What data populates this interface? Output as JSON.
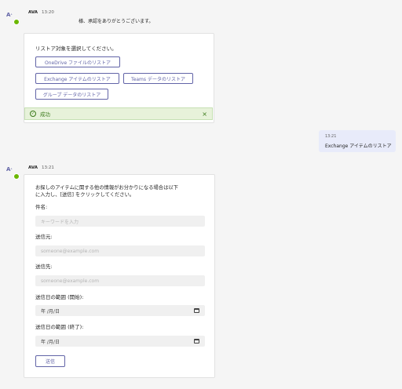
{
  "thread": {
    "msg1": {
      "avatar_text": "A",
      "sender": "AVA",
      "time": "13:20",
      "text": "様、承認をありがとうございます。",
      "card": {
        "prompt": "リストア対象を選択してください。",
        "buttons": [
          "OneDrive ファイルのリストア",
          "Exchange アイテムのリストア",
          "Teams データのリストア",
          "グループ データのリストア"
        ],
        "status": "成功"
      }
    },
    "reply": {
      "time": "13:21",
      "text": "Exchange アイテムのリストア"
    },
    "msg2": {
      "avatar_text": "A",
      "sender": "AVA",
      "time": "13:21",
      "card": {
        "intro_line1": "お探しのアイテムに関する他の情報がお分かりになる場合は以下",
        "intro_line2": "に入力し、[送信] をクリックしてください。",
        "subject_label": "件名:",
        "subject_placeholder": "キーワードを入力",
        "from_label": "送信元:",
        "from_placeholder": "someone@example.com",
        "to_label": "送信先:",
        "to_placeholder": "someone@example.com",
        "date_start_label": "送信日の範囲 (開始):",
        "date_start_value": "年 /月/日",
        "date_end_label": "送信日の範囲 (終了):",
        "date_end_value": "年 /月/日",
        "submit_label": "送信"
      }
    }
  },
  "colors": {
    "accent": "#6264a7",
    "success_bg": "#e7f2da",
    "success_text": "#3b7a1a",
    "presence": "#6bb700"
  },
  "icons": {
    "status": "check-circle-icon",
    "dismiss": "close-icon",
    "date": "calendar-icon"
  }
}
